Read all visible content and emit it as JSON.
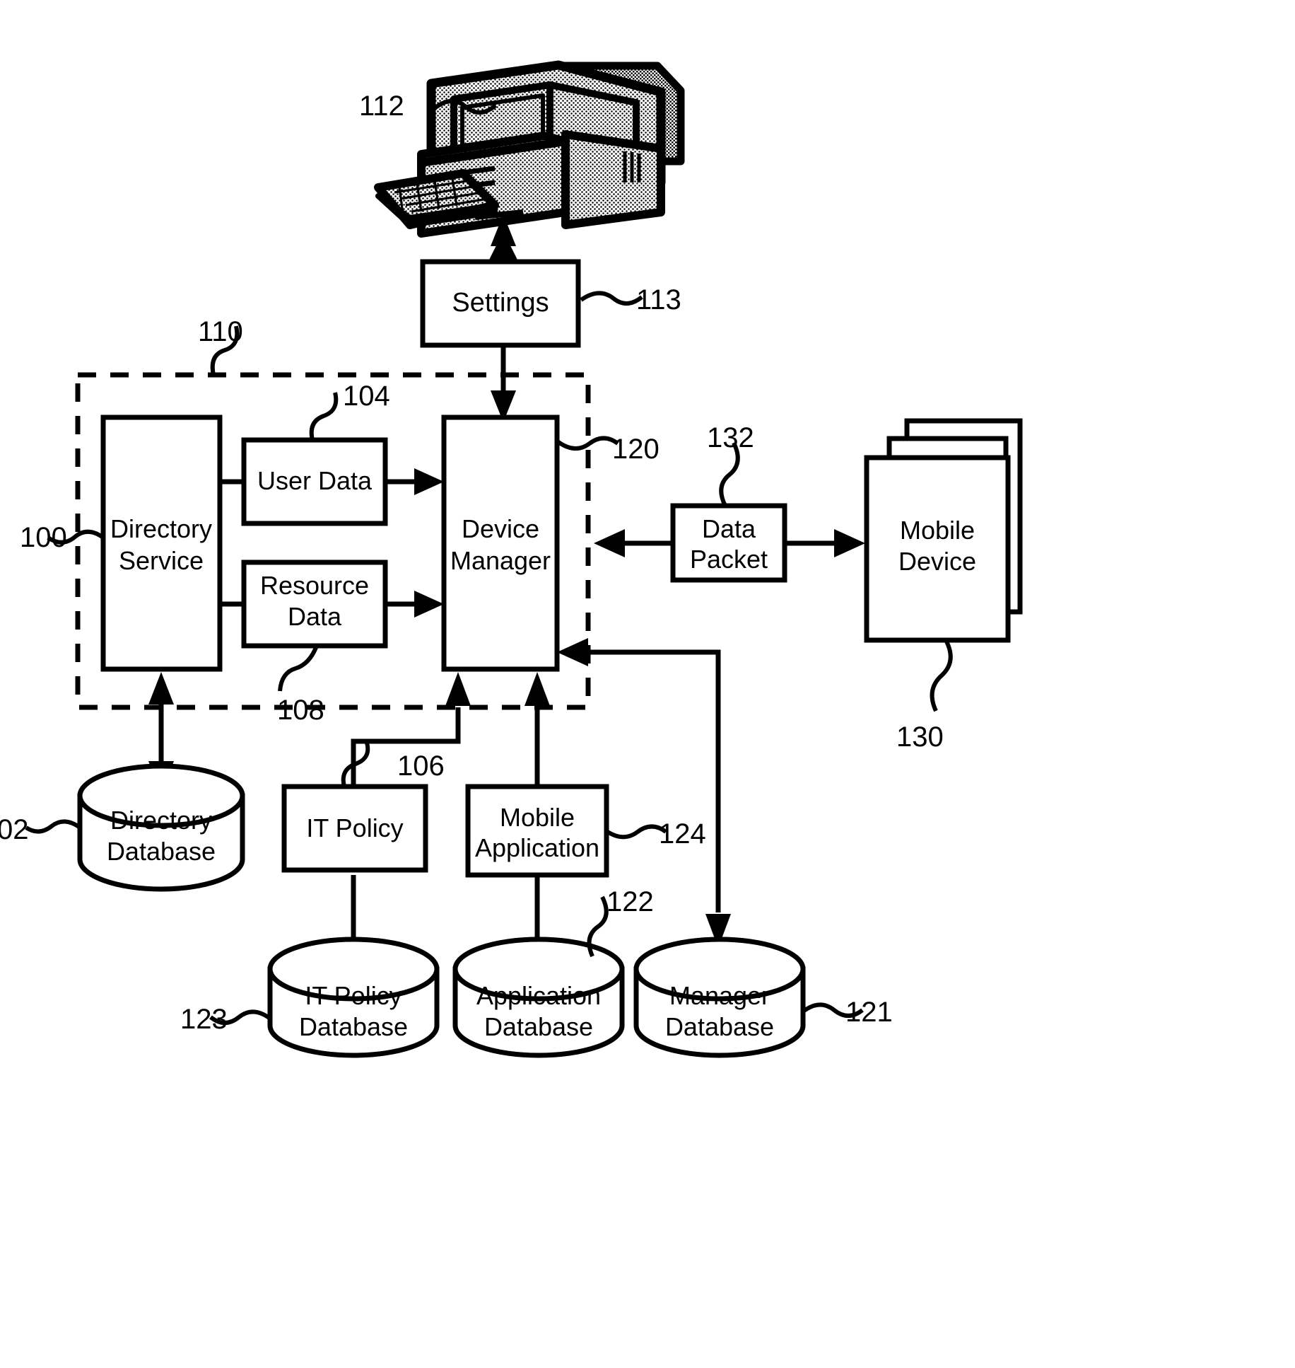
{
  "figure": {
    "type": "patent-system-block-diagram",
    "background": "#ffffff",
    "stroke": "#000000"
  },
  "nodes": {
    "workstation": {
      "label": "",
      "ref": "112",
      "shape": "computer-illustration"
    },
    "settings": {
      "label": "Settings",
      "ref": "113",
      "shape": "rectangle"
    },
    "directory_service": {
      "label_line1": "Directory",
      "label_line2": "Service",
      "ref": "100",
      "shape": "rectangle"
    },
    "user_data": {
      "label": "User Data",
      "ref": "104",
      "shape": "rectangle"
    },
    "resource_data": {
      "label_line1": "Resource",
      "label_line2": "Data",
      "ref": "108",
      "shape": "rectangle"
    },
    "device_manager": {
      "label_line1": "Device",
      "label_line2": "Manager",
      "ref": "120",
      "shape": "rectangle"
    },
    "data_packet": {
      "label_line1": "Data",
      "label_line2": "Packet",
      "ref": "132",
      "shape": "rectangle"
    },
    "mobile_device": {
      "label_line1": "Mobile",
      "label_line2": "Device",
      "ref": "130",
      "shape": "stacked-rectangles"
    },
    "directory_database": {
      "label_line1": "Directory",
      "label_line2": "Database",
      "ref": "02",
      "shape": "cylinder"
    },
    "it_policy": {
      "label": "IT Policy",
      "ref": "106",
      "shape": "rectangle"
    },
    "mobile_application": {
      "label_line1": "Mobile",
      "label_line2": "Application",
      "ref": "124",
      "shape": "rectangle"
    },
    "it_policy_database": {
      "label_line1": "IT Policy",
      "label_line2": "Database",
      "ref": "123",
      "shape": "cylinder"
    },
    "application_database": {
      "label_line1": "Application",
      "label_line2": "Database",
      "ref": "122",
      "shape": "cylinder"
    },
    "manager_database": {
      "label_line1": "Manager",
      "label_line2": "Database",
      "ref": "121",
      "shape": "cylinder"
    },
    "enterprise_boundary": {
      "ref": "110",
      "shape": "dashed-rectangle"
    }
  },
  "reference_numerals": [
    {
      "id": "112",
      "text": "112"
    },
    {
      "id": "113",
      "text": "113"
    },
    {
      "id": "110",
      "text": "110"
    },
    {
      "id": "104",
      "text": "104"
    },
    {
      "id": "100",
      "text": "100"
    },
    {
      "id": "120",
      "text": "120"
    },
    {
      "id": "132",
      "text": "132"
    },
    {
      "id": "130",
      "text": "130"
    },
    {
      "id": "108",
      "text": "108"
    },
    {
      "id": "106",
      "text": "106"
    },
    {
      "id": "124",
      "text": "124"
    },
    {
      "id": "122",
      "text": "122"
    },
    {
      "id": "123",
      "text": "123"
    },
    {
      "id": "121",
      "text": "121"
    },
    {
      "id": "02",
      "text": "02"
    }
  ],
  "connections": [
    {
      "from": "settings",
      "to": "workstation",
      "style": "arrow-up"
    },
    {
      "from": "settings",
      "to": "device_manager",
      "style": "arrow-down"
    },
    {
      "from": "directory_service",
      "to": "user_data",
      "style": "plain-line"
    },
    {
      "from": "directory_service",
      "to": "resource_data",
      "style": "plain-line"
    },
    {
      "from": "user_data",
      "to": "device_manager",
      "style": "arrow-right"
    },
    {
      "from": "resource_data",
      "to": "device_manager",
      "style": "arrow-right"
    },
    {
      "from": "data_packet",
      "to": "device_manager",
      "style": "arrow-left"
    },
    {
      "from": "data_packet",
      "to": "mobile_device",
      "style": "arrow-right"
    },
    {
      "from": "directory_service",
      "to": "directory_database",
      "style": "double-arrow-vertical"
    },
    {
      "from": "it_policy",
      "to": "device_manager",
      "style": "arrow-up-elbow"
    },
    {
      "from": "mobile_application",
      "to": "device_manager",
      "style": "arrow-up"
    },
    {
      "from": "it_policy",
      "to": "it_policy_database",
      "style": "plain-line"
    },
    {
      "from": "mobile_application",
      "to": "application_database",
      "style": "plain-line"
    },
    {
      "from": "device_manager",
      "to": "manager_database",
      "style": "arrow-down-elbow"
    }
  ]
}
